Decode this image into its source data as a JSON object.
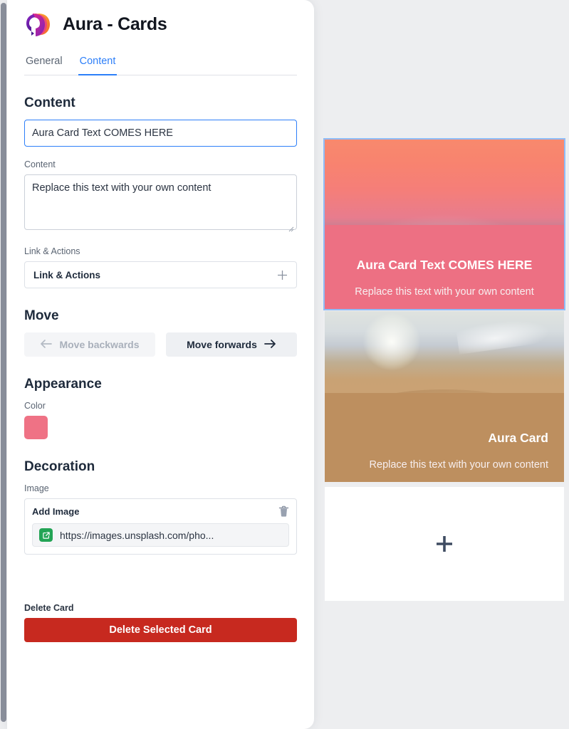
{
  "app": {
    "title": "Aura - Cards",
    "logo_icon": "aura-swoosh-logo"
  },
  "tabs": [
    {
      "label": "General",
      "active": false
    },
    {
      "label": "Content",
      "active": true
    }
  ],
  "content_section": {
    "heading": "Content",
    "title_input": {
      "value": "Aura Card Text COMES HERE",
      "placeholder": "Aura Card Text COMES HERE"
    },
    "content_label": "Content",
    "content_textarea": {
      "value": "Replace this text with your own content",
      "placeholder": "Replace this text with your own content"
    },
    "link_actions_label": "Link & Actions",
    "link_actions_row": {
      "label": "Link & Actions",
      "add_icon": "plus-icon"
    }
  },
  "move_section": {
    "heading": "Move",
    "backwards_button": {
      "label": "Move backwards",
      "icon": "arrow-left-icon",
      "disabled": true
    },
    "forwards_button": {
      "label": "Move forwards",
      "icon": "arrow-right-icon",
      "disabled": false
    }
  },
  "appearance_section": {
    "heading": "Appearance",
    "color_label": "Color",
    "color_value": "#EF7285"
  },
  "decoration_section": {
    "heading": "Decoration",
    "image_label": "Image",
    "image_card": {
      "title": "Add Image",
      "delete_icon": "trash-icon",
      "link_icon": "external-link-icon",
      "url": "https://images.unsplash.com/pho..."
    }
  },
  "delete_section": {
    "label": "Delete Card",
    "button_label": "Delete Selected Card",
    "button_color": "#C7291F"
  },
  "preview": {
    "cards": [
      {
        "title": "Aura Card Text COMES HERE",
        "subtitle": "Replace this text with your own content",
        "align": "center",
        "overlay_color": "#ED7083",
        "photo": "sunset-beach-photo",
        "selected": true
      },
      {
        "title": "Aura Card",
        "subtitle": "Replace this text with your own content",
        "align": "right",
        "overlay_color": "#BD8F5F",
        "photo": "desert-dunes-photo",
        "selected": false
      }
    ],
    "add_card": {
      "icon": "plus-icon",
      "icon_color": "#3E4B61"
    }
  }
}
